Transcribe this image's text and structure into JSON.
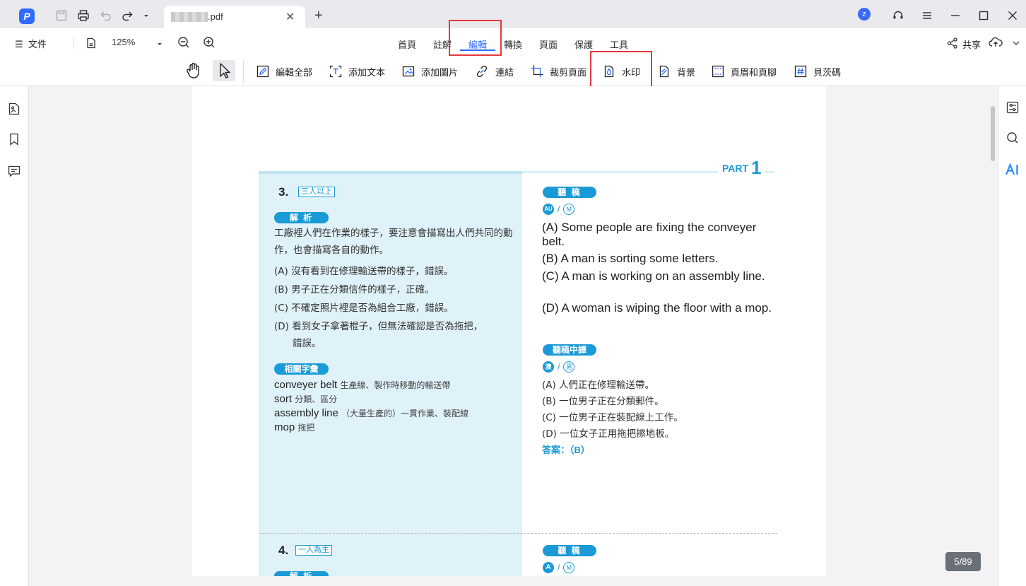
{
  "titlebar": {
    "tab_name": ".pdf",
    "avatar_letter": "z"
  },
  "menubar": {
    "file_label": "文件",
    "zoom_value": "125%",
    "tabs": [
      "首頁",
      "註解",
      "編輯",
      "轉換",
      "頁面",
      "保護",
      "工具"
    ],
    "active_tab": "編輯",
    "share_label": "共享"
  },
  "toolbar": {
    "edit_all": "編輯全部",
    "add_text": "添加文本",
    "add_image": "添加圖片",
    "link": "連結",
    "crop_page": "裁剪頁面",
    "watermark": "水印",
    "background": "背景",
    "header_footer": "頁眉和頁腳",
    "bates": "貝茨碼"
  },
  "page_counter": "5/89",
  "document": {
    "part": {
      "word": "PART",
      "num": "1"
    },
    "q3": {
      "number": "3.",
      "tag": "三人以上",
      "analysis_label": "解 析",
      "analysis_text": "工廠裡人們在作業的樣子，要注意會描寫出人們共同的動作，也會描寫各自的動作。",
      "options": [
        "(A) 沒有看到在修理輸送帶的樣子，錯誤。",
        "(B) 男子正在分類信件的樣子，正確。",
        "(C) 不確定照片裡是否為組合工廠，錯誤。",
        "(D) 看到女子拿著棍子，但無法確認是否為拖把，"
      ],
      "option_d_cont": "錯誤。",
      "vocab_label": "相關字彙",
      "vocab": [
        {
          "en": "conveyer belt",
          "zh": "生產線、製作時移動的輸送帶"
        },
        {
          "en": "sort",
          "zh": "分類、區分"
        },
        {
          "en": "assembly line",
          "zh": "（大量生產的）一貫作業、裝配線"
        },
        {
          "en": "mop",
          "zh": "拖把"
        }
      ],
      "script_label": "聽 稿",
      "speaker_a": "AU",
      "speaker_b": "M",
      "script": [
        {
          "key": "(A)",
          "text": "Some people are fixing the conveyer belt."
        },
        {
          "key": "(B)",
          "text": "A man is sorting some letters."
        },
        {
          "key": "(C)",
          "text": "A man is working on an assembly line."
        },
        {
          "key": "(D)",
          "text": "A woman is wiping the floor with a mop."
        }
      ],
      "translation_label": "聽稿中譯",
      "trans_speaker_a": "澳",
      "trans_speaker_b": "男",
      "translation": [
        "(A) 人們正在修理輸送帶。",
        "(B) 一位男子正在分類郵件。",
        "(C) 一位男子正在裝配線上工作。",
        "(D) 一位女子正用拖把擦地板。"
      ],
      "answer": "答案：（B）"
    },
    "q4": {
      "number": "4.",
      "tag": "一人為主",
      "analysis_label": "解 析",
      "script_label": "聽 稿",
      "speaker_a": "A",
      "speaker_b": "M"
    }
  }
}
